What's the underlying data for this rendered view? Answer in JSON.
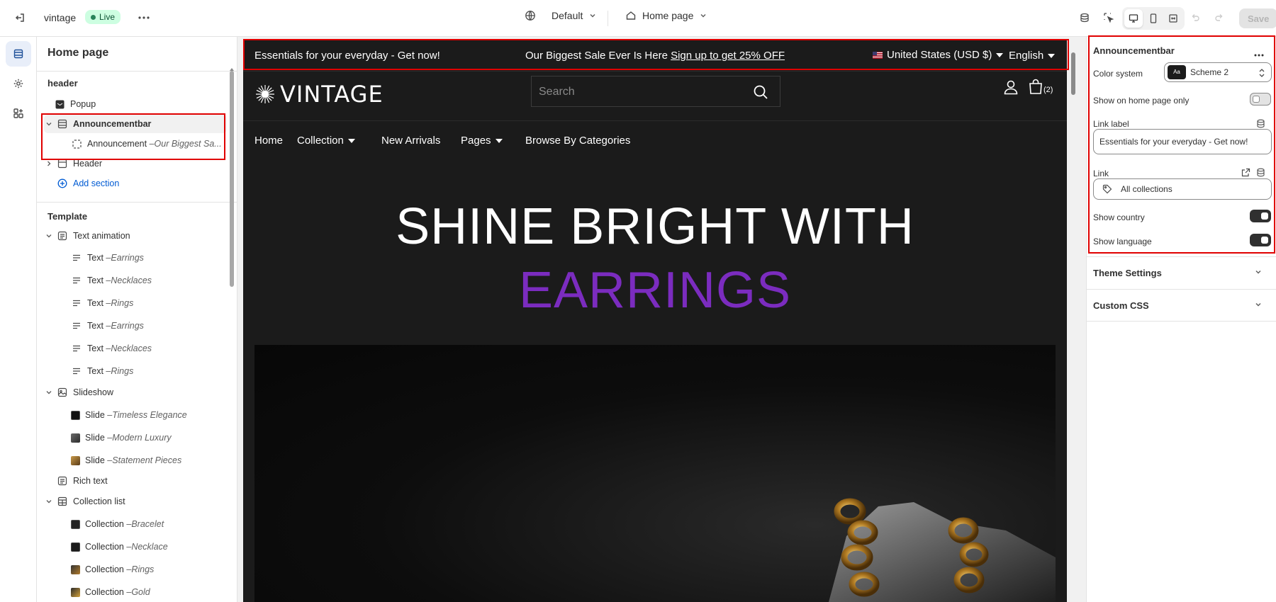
{
  "topbar": {
    "store_name": "vintage",
    "live_label": "Live",
    "theme_label": "Default",
    "page_label": "Home page",
    "save_label": "Save"
  },
  "left_panel": {
    "title": "Home page",
    "header_group": "header",
    "header_items": [
      {
        "label": "Popup",
        "sub": ""
      },
      {
        "label": "Announcementbar",
        "sub": ""
      },
      {
        "label": "Announcement",
        "sub": "Our Biggest Sa..."
      },
      {
        "label": "Header",
        "sub": ""
      }
    ],
    "add_section": "Add section",
    "template_group": "Template",
    "template_items": [
      {
        "label": "Text animation",
        "sub": ""
      },
      {
        "label": "Text",
        "sub": "Earrings"
      },
      {
        "label": "Text",
        "sub": "Necklaces"
      },
      {
        "label": "Text",
        "sub": "Rings"
      },
      {
        "label": "Text",
        "sub": "Earrings"
      },
      {
        "label": "Text",
        "sub": "Necklaces"
      },
      {
        "label": "Text",
        "sub": "Rings"
      },
      {
        "label": "Slideshow",
        "sub": ""
      },
      {
        "label": "Slide",
        "sub": "Timeless Elegance"
      },
      {
        "label": "Slide",
        "sub": "Modern Luxury"
      },
      {
        "label": "Slide",
        "sub": "Statement Pieces"
      },
      {
        "label": "Rich text",
        "sub": ""
      },
      {
        "label": "Collection list",
        "sub": ""
      },
      {
        "label": "Collection",
        "sub": "Bracelet"
      },
      {
        "label": "Collection",
        "sub": "Necklace"
      },
      {
        "label": "Collection",
        "sub": "Rings"
      },
      {
        "label": "Collection",
        "sub": "Gold"
      }
    ]
  },
  "preview": {
    "announcement": {
      "left_text": "Essentials for your everyday - Get now!",
      "center_text": "Our Biggest Sale Ever Is Here",
      "center_link": "Sign up to get 25% OFF",
      "country": "United States (USD $)",
      "language": "English"
    },
    "logo_text": "VINTAGE",
    "search_placeholder": "Search",
    "cart_count": "(2)",
    "nav": [
      "Home",
      "Collection",
      "New Arrivals",
      "Pages",
      "Browse By Categories"
    ],
    "hero_line1": "SHINE BRIGHT WITH",
    "hero_line2": "EARRINGS",
    "colors": {
      "accent": "#7b2cbf",
      "background": "#1b1b1b"
    }
  },
  "right_panel": {
    "title": "Announcementbar",
    "color_system_label": "Color system",
    "color_scheme_value": "Scheme 2",
    "scheme_swatch_text": "Aa",
    "show_home_only_label": "Show on home page only",
    "show_home_only": false,
    "link_label_label": "Link label",
    "link_label_value": "Essentials for your everyday - Get now!",
    "link_label": "Link",
    "link_value": "All collections",
    "show_country_label": "Show country",
    "show_country": true,
    "show_language_label": "Show language",
    "show_language": true,
    "theme_settings": "Theme Settings",
    "custom_css": "Custom CSS"
  }
}
